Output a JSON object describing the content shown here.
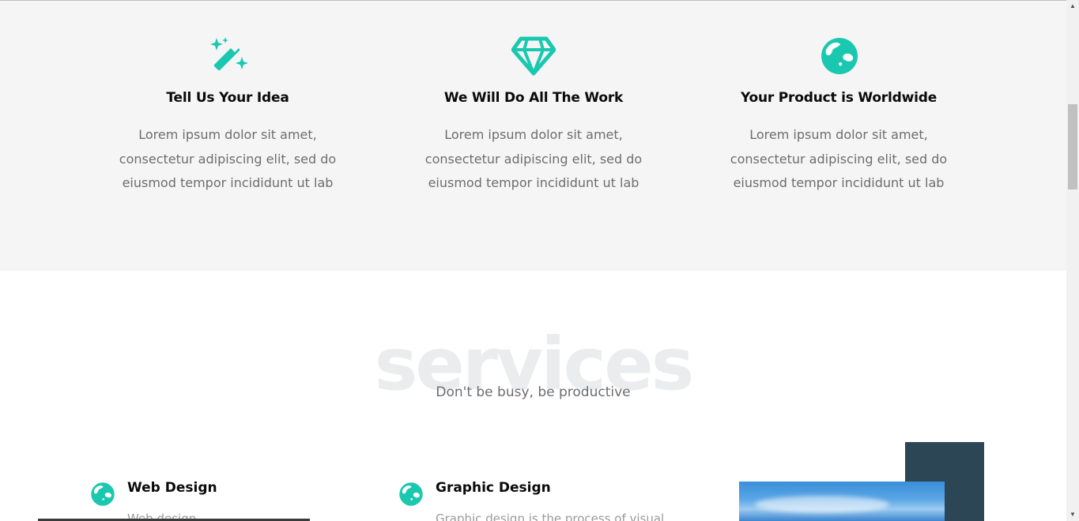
{
  "features": [
    {
      "icon": "magic-wand-icon",
      "title": "Tell Us Your Idea",
      "description": "Lorem ipsum dolor sit amet, consectetur adipiscing elit, sed do eiusmod tempor incididunt ut lab"
    },
    {
      "icon": "diamond-icon",
      "title": "We Will Do All The Work",
      "description": "Lorem ipsum dolor sit amet, consectetur adipiscing elit, sed do eiusmod tempor incididunt ut lab"
    },
    {
      "icon": "globe-icon",
      "title": "Your Product is Worldwide",
      "description": "Lorem ipsum dolor sit amet, consectetur adipiscing elit, sed do eiusmod tempor incididunt ut lab"
    }
  ],
  "services": {
    "heading": "services",
    "subtitle": "Don't be busy, be productive",
    "items": [
      {
        "icon": "globe-icon",
        "title": "Web Design",
        "description": "Web design"
      },
      {
        "icon": "globe-icon",
        "title": "Graphic Design",
        "description": "Graphic design is the process of visual"
      }
    ]
  },
  "colors": {
    "accent": "#1ac8b0",
    "dark_block": "#2c4655",
    "band_bg": "#f5f5f5"
  }
}
